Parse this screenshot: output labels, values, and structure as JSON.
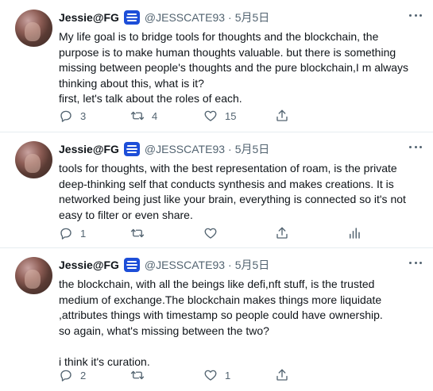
{
  "tweets": [
    {
      "name": "Jessie@FG",
      "handle": "@JESSCATE93",
      "separator": "·",
      "date": "5月5日",
      "text": "My life goal is to bridge tools for thoughts and the blockchain, the\npurpose is to make human thoughts valuable. but there is something\nmissing between people's thoughts and the pure blockchain,I m always\nthinking about this, what is it?\nfirst, let's talk about the roles of each.",
      "replies": "3",
      "retweets": "4",
      "likes": "15"
    },
    {
      "name": "Jessie@FG",
      "handle": "@JESSCATE93",
      "separator": "·",
      "date": "5月5日",
      "text": "tools for thoughts, with the best representation of roam, is the private\ndeep-thinking self that conducts synthesis and makes creations. It is\nnetworked being just like your brain, everything is connected so it's not\neasy to filter or even share.",
      "replies": "1",
      "retweets": "",
      "likes": ""
    },
    {
      "name": "Jessie@FG",
      "handle": "@JESSCATE93",
      "separator": "·",
      "date": "5月5日",
      "text": "the blockchain, with all the beings like defi,nft stuff, is the trusted\nmedium of exchange.The blockchain makes things more liquidate\n,attributes things with timestamp so people could have ownership.\nso again, what's missing between the two?\n\ni think it's curation.",
      "replies": "2",
      "retweets": "",
      "likes": "1"
    }
  ],
  "colors": {
    "text": "#0f1419",
    "secondary": "#536471",
    "divider": "#e6ecf0",
    "badge": "#1d4ed8"
  },
  "icons": {
    "reply": "reply-icon",
    "retweet": "retweet-icon",
    "like": "heart-icon",
    "share": "share-icon",
    "stats": "stats-icon",
    "more": "more-icon",
    "badge": "badge-icon"
  }
}
